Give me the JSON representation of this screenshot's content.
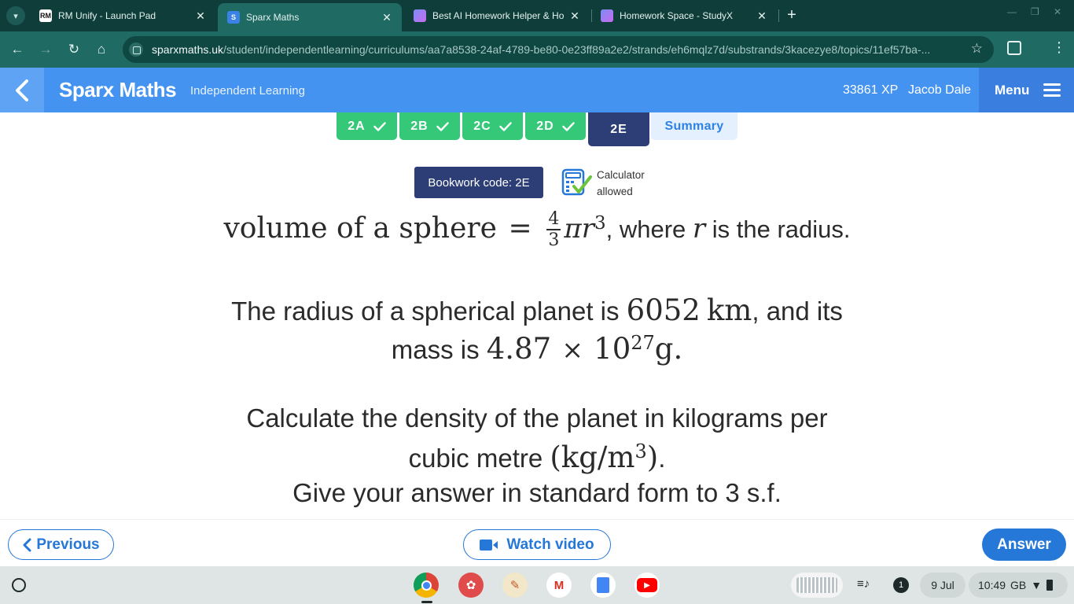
{
  "browser": {
    "tabs": [
      {
        "title": "RM Unify - Launch Pad",
        "favicon": "RM"
      },
      {
        "title": "Sparx Maths",
        "favicon": "S"
      },
      {
        "title": "Best AI Homework Helper & Ho",
        "favicon": "cube-icon"
      },
      {
        "title": "Homework Space - StudyX",
        "favicon": "cube-icon"
      }
    ],
    "url_host": "sparxmaths.uk",
    "url_path": "/student/independentlearning/curriculums/aa7a8538-24af-4789-be80-0e23ff89a2e2/strands/eh6mqlz7d/substrands/3kacezye8/topics/11ef57ba-..."
  },
  "header": {
    "brand": "Sparx Maths",
    "subtitle": "Independent Learning",
    "xp": "33861 XP",
    "user": "Jacob Dale",
    "menu_label": "Menu"
  },
  "task_tabs": [
    {
      "label": "2A",
      "status": "done"
    },
    {
      "label": "2B",
      "status": "done"
    },
    {
      "label": "2C",
      "status": "done"
    },
    {
      "label": "2D",
      "status": "done"
    },
    {
      "label": "2E",
      "status": "current"
    },
    {
      "label": "Summary",
      "status": "summary"
    }
  ],
  "question": {
    "bookwork_code": "Bookwork code: 2E",
    "calculator_line1": "Calculator",
    "calculator_line2": "allowed",
    "formula_lhs": "volume of a sphere",
    "formula_eq": "=",
    "formula_num": "4",
    "formula_den": "3",
    "formula_pi": "π",
    "formula_r": "r",
    "formula_exp": "3",
    "formula_where": ", where",
    "formula_var": "r",
    "formula_tail": "is the radius.",
    "radius_text_1": "The radius of a spherical planet is",
    "radius_value": "6052",
    "radius_unit": "km",
    "radius_text_2": ", and its",
    "mass_text": "mass is",
    "mass_coeff": "4.87",
    "mass_times": "×",
    "mass_base": "10",
    "mass_exp": "27",
    "mass_unit": "g",
    "mass_end": ".",
    "calc_text_1": "Calculate the density of the planet in kilograms per",
    "calc_text_2": "cubic metre",
    "density_unit": "(kg/m",
    "density_exp": "3",
    "density_close": ")",
    "calc_end": ".",
    "instruction": "Give your answer in standard form to 3 s.f."
  },
  "actions": {
    "previous": "Previous",
    "watch_video": "Watch video",
    "answer": "Answer"
  },
  "shelf": {
    "apps": [
      "chrome-icon",
      "palette-icon",
      "canvas-icon",
      "gmail-icon",
      "docs-icon",
      "youtube-icon"
    ],
    "notification_count": "1",
    "date": "9 Jul",
    "time": "10:49",
    "locale": "GB"
  },
  "colors": {
    "browser_dark": "#0e3d3a",
    "browser_toolbar": "#1f6a63",
    "sparx_blue": "#4493f0",
    "task_done": "#34c878",
    "task_current": "#2c3e75",
    "button_blue": "#2577d8"
  }
}
